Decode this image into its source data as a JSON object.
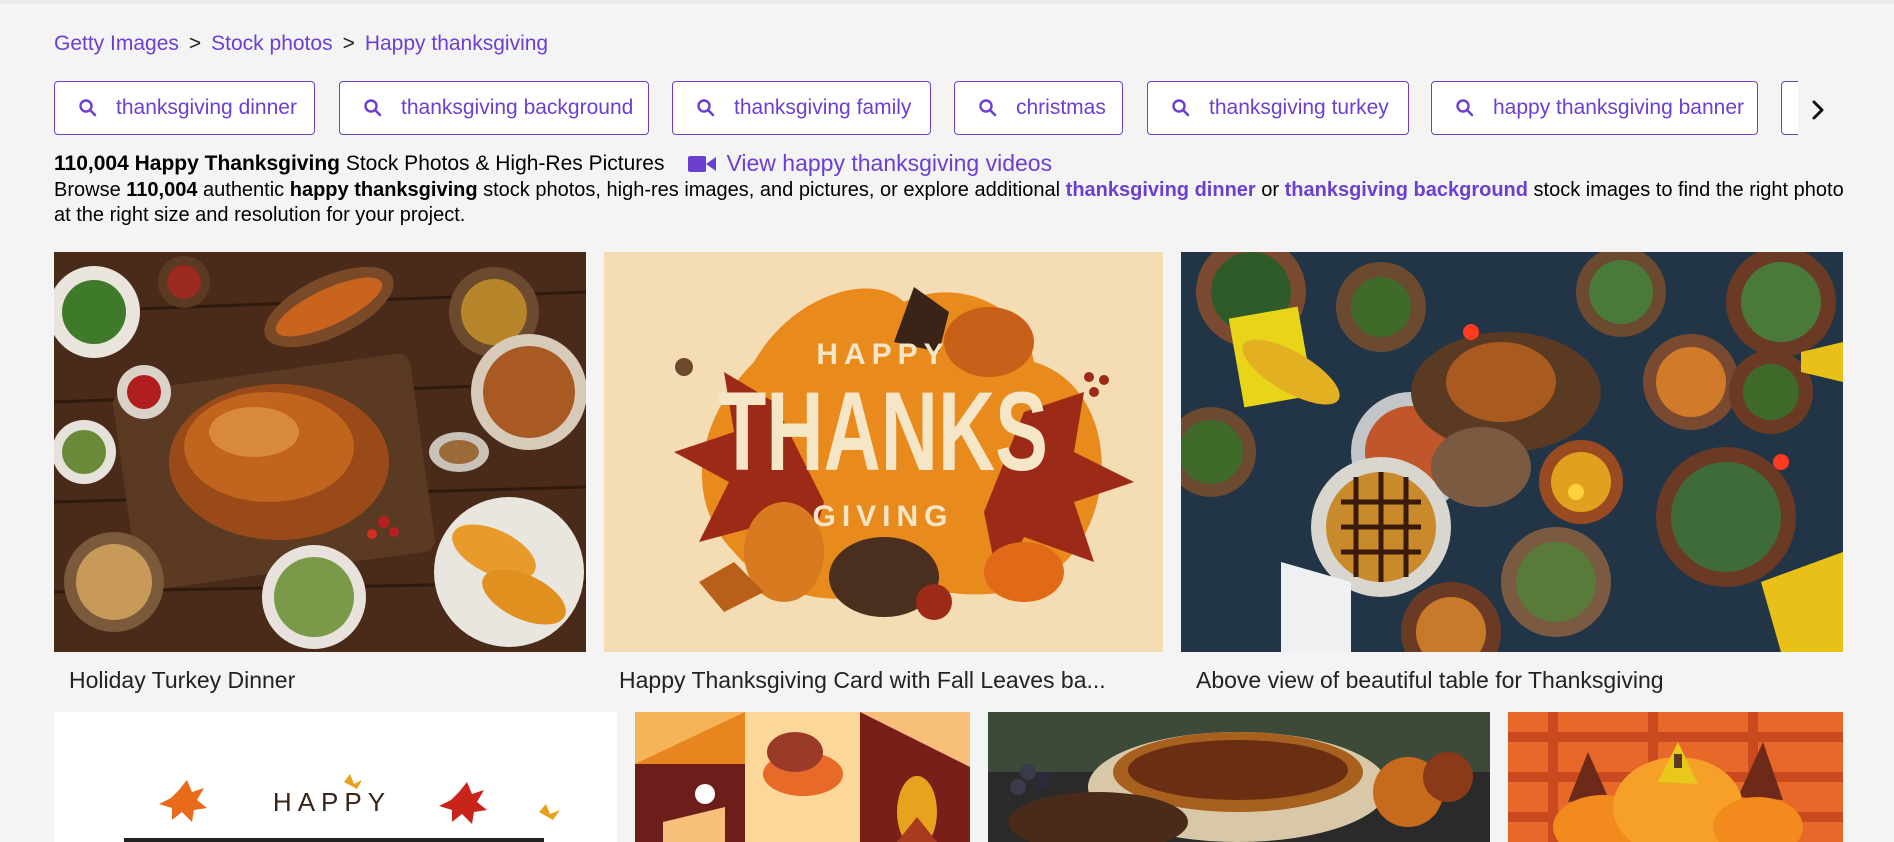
{
  "breadcrumb": {
    "items": [
      "Getty Images",
      "Stock photos",
      "Happy thanksgiving"
    ],
    "separator": ">"
  },
  "related_searches": [
    "thanksgiving dinner",
    "thanksgiving background",
    "thanksgiving family",
    "christmas",
    "thanksgiving turkey",
    "happy thanksgiving banner"
  ],
  "header": {
    "count": "110,004",
    "query_title": "Happy Thanksgiving",
    "suffix": "Stock Photos & High-Res Pictures",
    "video_link": "View happy thanksgiving videos"
  },
  "description": {
    "p1": "Browse ",
    "count": "110,004",
    "p2": " authentic ",
    "query": "happy thanksgiving",
    "p3": " stock photos, high-res images, and pictures, or explore additional ",
    "link1": "thanksgiving dinner",
    "p4": " or ",
    "link2": "thanksgiving background",
    "p5": " stock images to find the right photo at the right size and resolution for your project."
  },
  "results": [
    {
      "caption": "Holiday Turkey Dinner"
    },
    {
      "caption": "Happy Thanksgiving Card with Fall Leaves ba...",
      "art_text": [
        "HAPPY",
        "THANKS",
        "GIVING"
      ]
    },
    {
      "caption": "Above view of beautiful table for Thanksgiving"
    },
    {
      "caption": "",
      "art_text": "HAPPY"
    },
    {
      "caption": ""
    },
    {
      "caption": ""
    },
    {
      "caption": ""
    }
  ],
  "colors": {
    "accent": "#6c3fd1",
    "background": "#f4f4f4"
  },
  "icons": {
    "chip": "search-icon",
    "next": "chevron-right-icon",
    "video": "video-camera-icon"
  }
}
